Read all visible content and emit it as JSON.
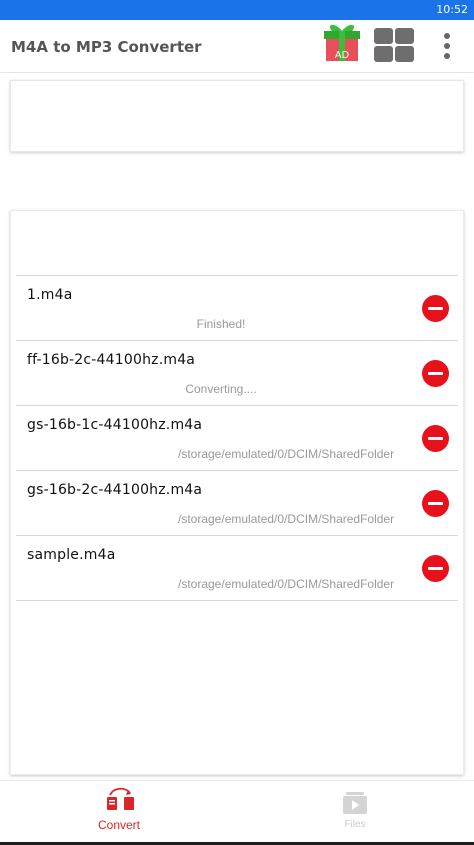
{
  "status_bar": {
    "time": "10:52"
  },
  "app_bar": {
    "title": "M4A to MP3 Converter",
    "ad_label": "AD"
  },
  "files": [
    {
      "name": "1.m4a",
      "status": "Finished!",
      "kind": "status"
    },
    {
      "name": "ff-16b-2c-44100hz.m4a",
      "status": "Converting....",
      "kind": "status"
    },
    {
      "name": "gs-16b-1c-44100hz.m4a",
      "status": "/storage/emulated/0/DCIM/SharedFolder",
      "kind": "path"
    },
    {
      "name": "gs-16b-2c-44100hz.m4a",
      "status": "/storage/emulated/0/DCIM/SharedFolder",
      "kind": "path"
    },
    {
      "name": "sample.m4a",
      "status": "/storage/emulated/0/DCIM/SharedFolder",
      "kind": "path"
    }
  ],
  "bottom_nav": {
    "convert_label": "Convert",
    "files_label": "Files"
  },
  "colors": {
    "status_bar": "#1a73e8",
    "accent_red": "#d8262b",
    "remove_red": "#e8101a",
    "ad_green": "#3bbf3b"
  },
  "icons": [
    "gift-ad-icon",
    "grid-icon",
    "more-vert-icon",
    "remove-icon",
    "convert-icon",
    "files-icon"
  ]
}
